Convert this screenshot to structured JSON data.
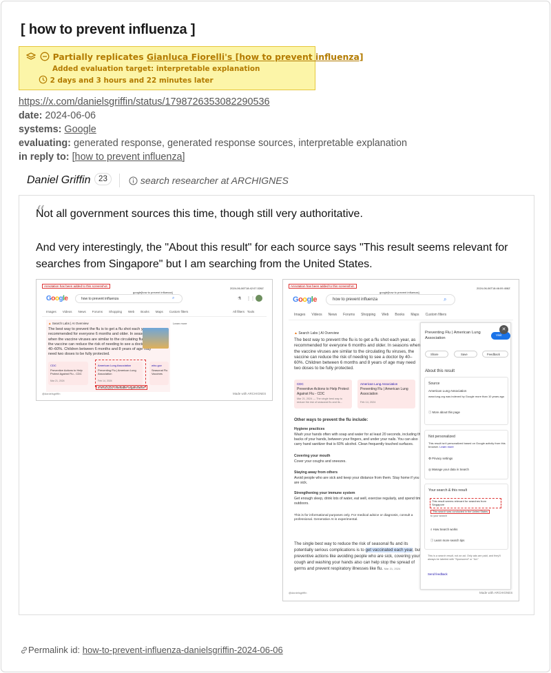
{
  "page": {
    "title": "[ how to prevent influenza ]",
    "replication": {
      "prefix": "Partially replicates",
      "target_link": "Gianluca Fiorelli's [how to prevent influenza]",
      "added": "Added evaluation target: interpretable explanation",
      "time_later": "2 days and 3 hours and 22 minutes later"
    },
    "meta": {
      "url": "https://x.com/danielsgriffin/status/1798726353082290536",
      "date_label": "date:",
      "date": "2024-06-06",
      "systems_label": "systems:",
      "systems": "Google",
      "evaluating_label": "evaluating:",
      "evaluating": "generated response, generated response sources, interpretable explanation",
      "reply_label": "in reply to:",
      "reply": "[how to prevent influenza]"
    },
    "author": {
      "name": "Daniel Griffin",
      "count": "23",
      "role": "search researcher at ARCHIGNES"
    },
    "quote": {
      "p1": "Not all government sources this time, though still very authoritative.",
      "p2": "And very interestingly, the \"About this result\" for each source says \"This result seems relevant for searches from Singapore\" but I am searching from the United States."
    },
    "permalink": {
      "label": "Permalink id:",
      "id": "how-to-prevent-influenza-danielsgriffin-2024-06-06"
    }
  },
  "shot1": {
    "annotation": "Annotation has been added to this screenshot.",
    "header": "google[how to prevent influenza]",
    "timestamp": "2024-06-06T18:42:07.026Z",
    "query": "how to prevent influenza",
    "tabs": [
      "Images",
      "Videos",
      "News",
      "Forums",
      "Shopping",
      "Web",
      "Books",
      "Maps",
      "Custom filters"
    ],
    "tools": [
      "All filters",
      "Tools"
    ],
    "overview_label": "Search Labs | AI Overview",
    "learn_more": "Learn more",
    "overview_text": "The best way to prevent the flu is to get a flu shot each year, as recommended for everyone 6 months and older. In seasons when the vaccine viruses are similar to the circulating flu viruses, the vaccine can reduce the risk of needing to see a doctor by 40–60%. Children between 6 months and 8 years of age may need two doses to be fully protected.",
    "sources": [
      {
        "name": "CDC",
        "title": "Preventive Actions to Help Protect Against Flu - CDC",
        "date": "Mar 21, 2024"
      },
      {
        "name": "American Lung Association",
        "title": "Preventing Flu | American Lung Association",
        "date": "Feb 14, 2024"
      },
      {
        "name": "who.gov",
        "title": "Seasonal Flu Vaccines",
        "date": ""
      }
    ],
    "footnote": "a 501(c)(3) charitable organization",
    "handle": "@danielsgriffin",
    "made_with": "Made with ARCHIGNES"
  },
  "shot2": {
    "annotation": "Annotation has been added to this screenshot.",
    "header": "google[how to prevent influenza]",
    "timestamp": "2024-06-06T18:46:09.408Z",
    "query": "how to prevent influenza",
    "tabs": [
      "Images",
      "Videos",
      "News",
      "Forums",
      "Shopping",
      "Web",
      "Books",
      "Maps",
      "Custom filters"
    ],
    "overview_label": "Search Labs | AI Overview",
    "overview_text": "The best way to prevent the flu is to get a flu shot each year, as recommended for everyone 6 months and older. In seasons when the vaccine viruses are similar to the circulating flu viruses, the vaccine can reduce the risk of needing to see a doctor by 40–60%. Children between 6 months and 8 years of age may need two doses to be fully protected.",
    "sources": [
      {
        "name": "CDC",
        "title": "Preventive Actions to Help Protect Against Flu - CDC",
        "snippet": "Mar 21, 2024 — The single best way to reduce the risk of seasonal flu and its..."
      },
      {
        "name": "American Lung Association",
        "title": "Preventing Flu | American Lung Association",
        "snippet": "Feb 14, 2024"
      }
    ],
    "other_ways": "Other ways to prevent the flu include:",
    "sections": [
      {
        "h": "Hygiene practices",
        "t": "Wash your hands often with soap and water for at least 20 seconds, including the backs of your hands, between your fingers, and under your nails. You can also carry hand sanitizer that is 60% alcohol. Clean frequently touched surfaces."
      },
      {
        "h": "Covering your mouth",
        "t": "Cover your coughs and sneezes."
      },
      {
        "h": "Staying away from others",
        "t": "Avoid people who are sick and keep your distance from them. Stay home if you are sick."
      },
      {
        "h": "Strengthening your immune system",
        "t": "Get enough sleep, drink lots of water, eat well, exercise regularly, and spend time outdoors."
      }
    ],
    "disclaimer": "This is for informational purposes only. For medical advice or diagnosis, consult a professional. Generative AI is experimental.",
    "bottom_text_a": "The single best way to reduce the risk of seasonal flu and its potentially serious complications is to ",
    "bottom_highlight": "get vaccinated each year",
    "bottom_text_b": ", but preventive actions like avoiding people who are sick, covering your cough and washing your hands also can help stop the spread of germs and prevent respiratory illnesses like flu.",
    "bottom_date": "Mar 21, 2024",
    "panel": {
      "title": "Preventing Flu | American Lung Association",
      "visit": "Visit",
      "share": "Share",
      "save": "Save",
      "feedback": "Feedback",
      "about": "About this result",
      "source_h": "Source",
      "source_name": "American Lung Association",
      "source_desc": "www.lung.org was indexed by Google more than 10 years ago",
      "more_about": "More about this page",
      "np_h": "Not personalized",
      "np_text": "This result isn't personalized based on Google activity from this browser.",
      "np_learn": "Learn more",
      "privacy": "Privacy settings",
      "manage": "Manage your data in Search",
      "ys_h": "Your search & this result",
      "relevant": "This result seems relevant for searches from Singapore",
      "us_note": "This search was conducted in the United States",
      "to_your": "to your search",
      "how_works": "How Search works",
      "learn_tips": "Learn more search tips",
      "footer": "This is a search result, not an ad. Only ads are paid, and they'll always be labeled with \"Sponsored\" or \"Ad.\"",
      "send_feedback": "Send feedback"
    },
    "handle": "@danielsgriffin",
    "made_with": "Made with ARCHIGNES"
  },
  "colors": {
    "accent": "#b37b00",
    "highlight": "#fcf5a8",
    "overview_bg": "#fdf2f2"
  }
}
